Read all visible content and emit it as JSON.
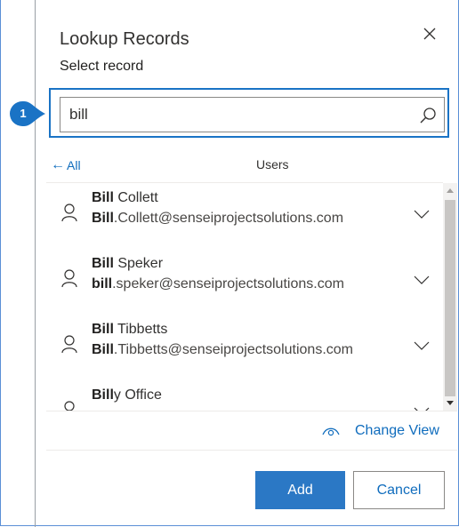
{
  "dialog": {
    "title": "Lookup Records",
    "subtitle": "Select record",
    "close_icon": "close-icon"
  },
  "search": {
    "value": "bill",
    "icon": "search-icon",
    "step_badge": "1"
  },
  "list": {
    "back_label": "All",
    "back_icon": "arrow-left-icon",
    "header": "Users",
    "records": [
      {
        "name_match": "Bill",
        "name_rest": " Collett",
        "email_match": "Bill",
        "email_rest": ".Collett@senseiprojectsolutions.com"
      },
      {
        "name_match": "Bill",
        "name_rest": " Speker",
        "email_match": "bill",
        "email_rest": ".speker@senseiprojectsolutions.com"
      },
      {
        "name_match": "Bill",
        "name_rest": " Tibbetts",
        "email_match": "Bill",
        "email_rest": ".Tibbetts@senseiprojectsolutions.com"
      },
      {
        "name_match": "Bill",
        "name_rest": "y Office",
        "email_match": "",
        "email_rest": ""
      }
    ]
  },
  "change_view": {
    "label": "Change View",
    "icon": "eye-icon"
  },
  "buttons": {
    "add": "Add",
    "cancel": "Cancel"
  },
  "colors": {
    "accent": "#0f6cbd",
    "primary_button": "#2b78c5",
    "focus_border": "#1a73c5",
    "badge": "#1a73c5"
  }
}
